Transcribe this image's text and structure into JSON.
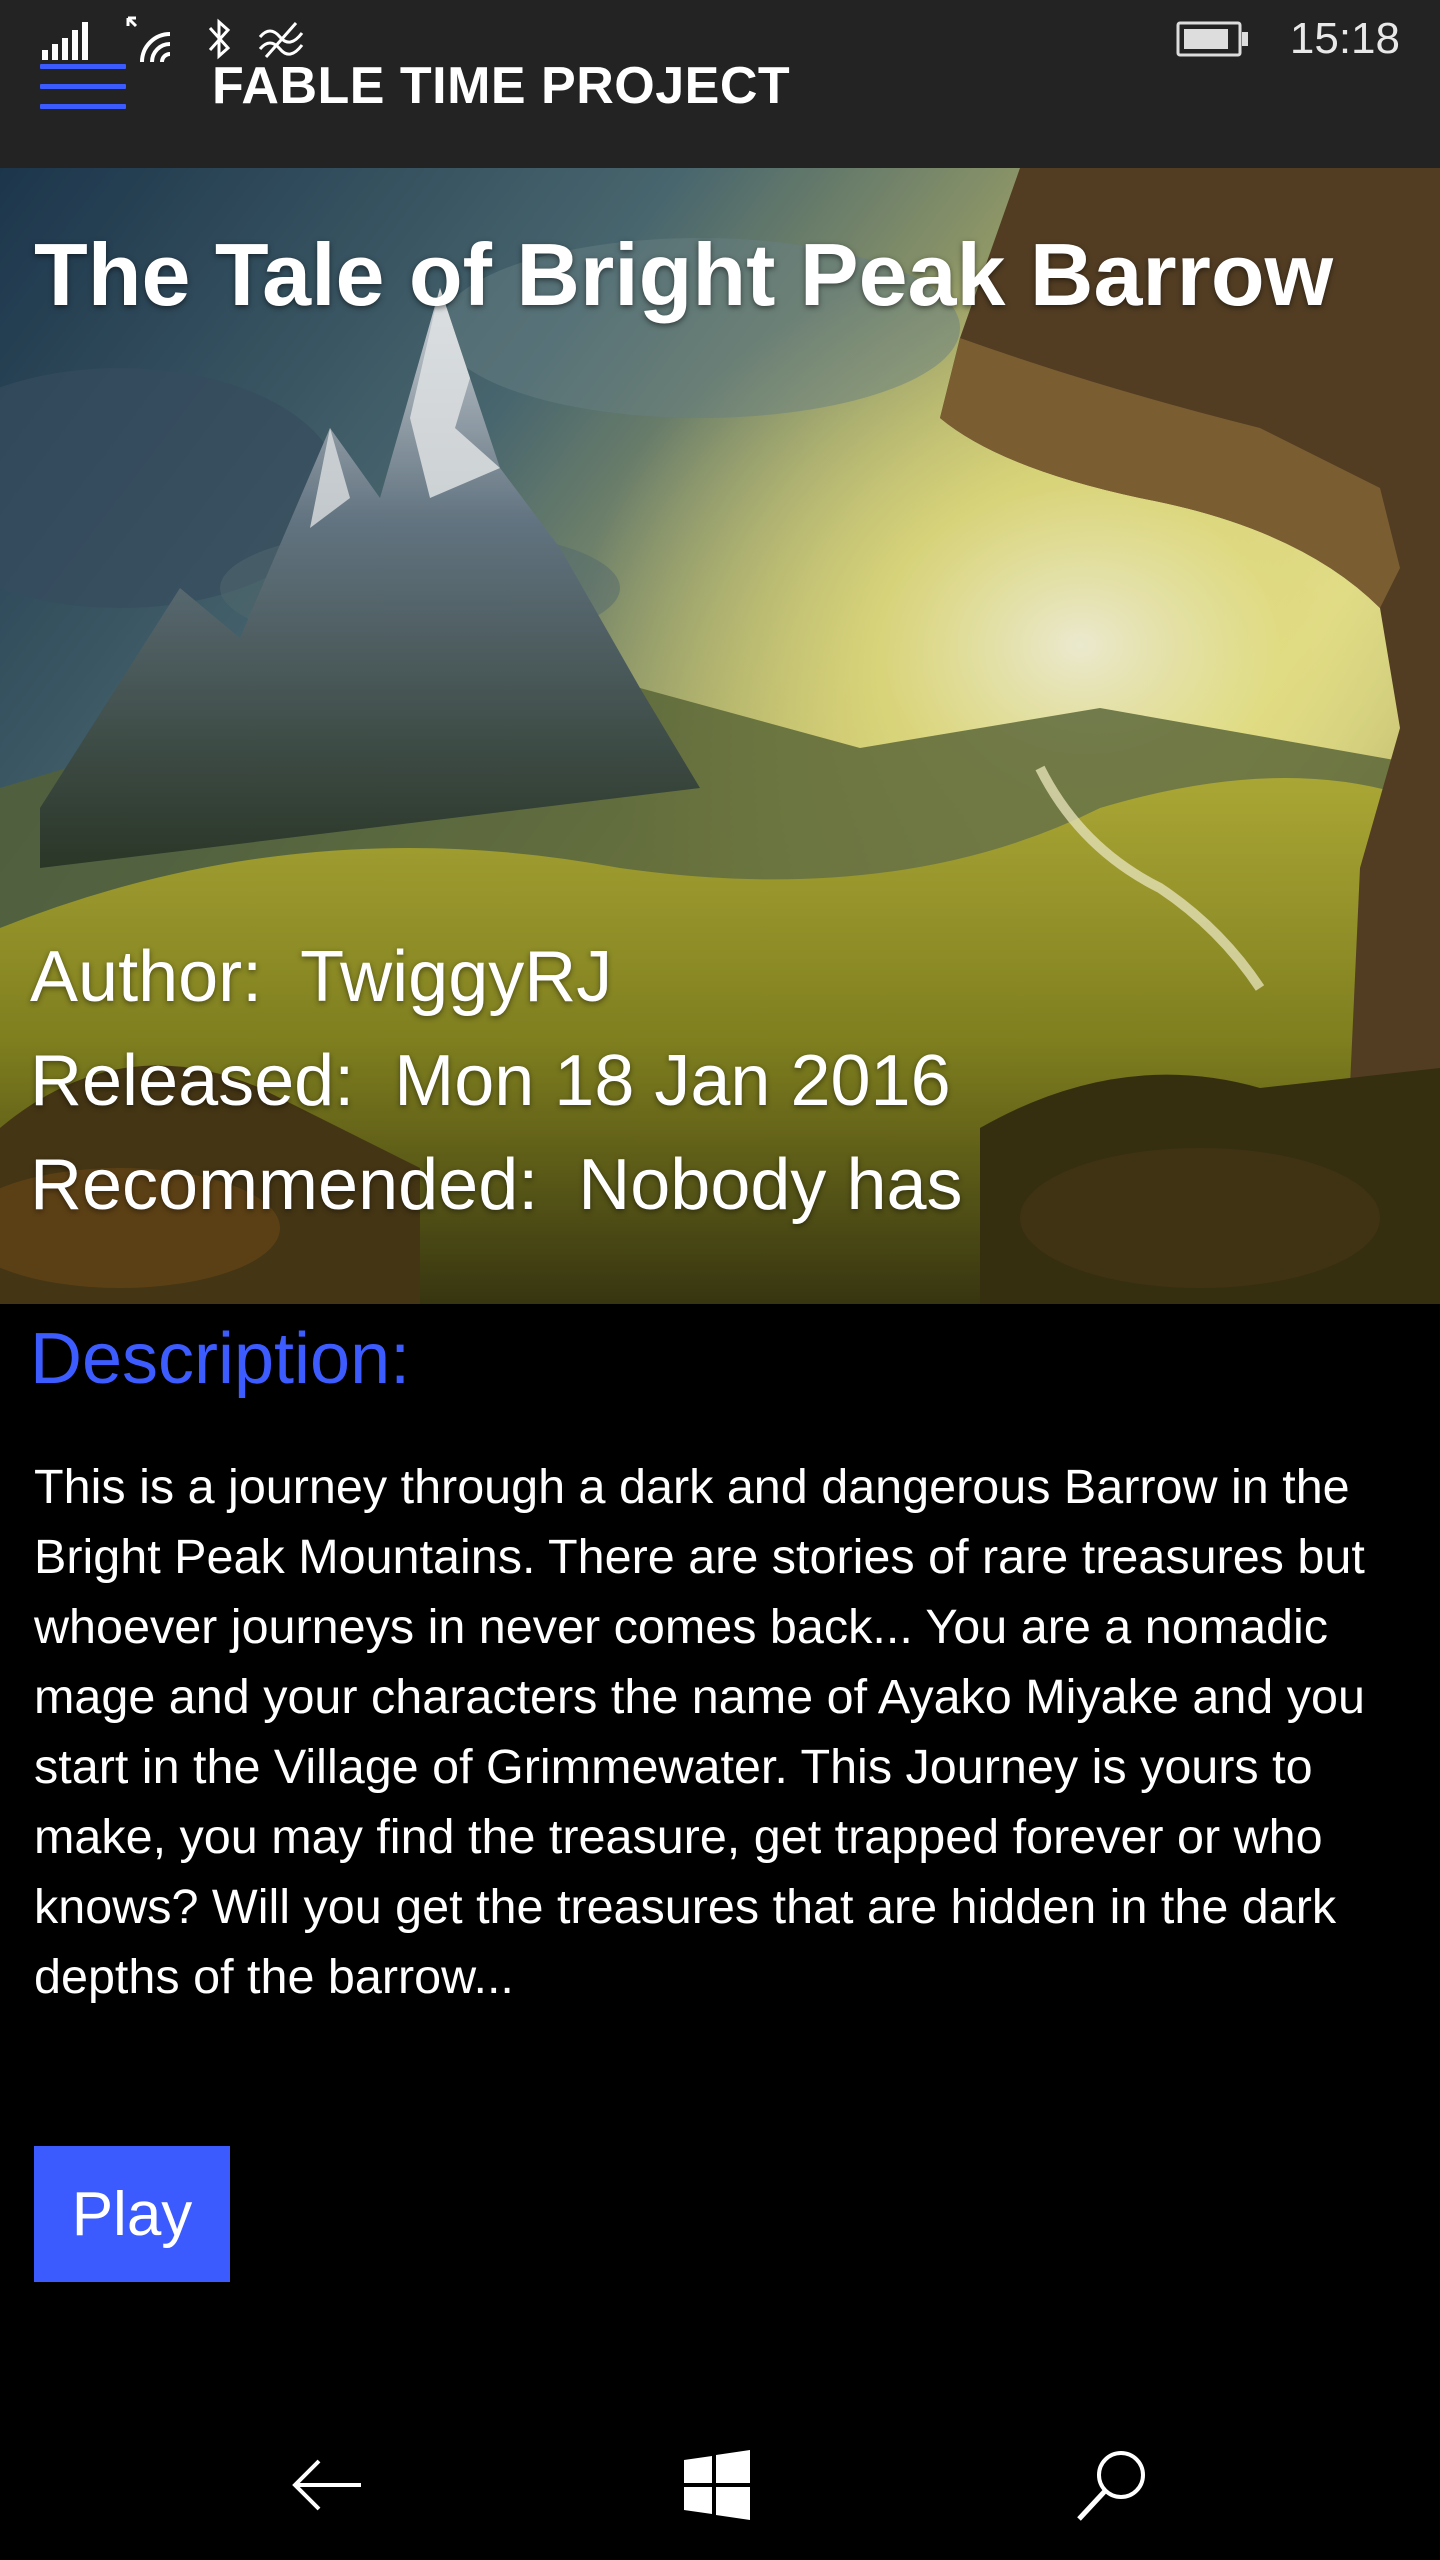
{
  "status_bar": {
    "time": "15:18",
    "icons": [
      "signal-icon",
      "wifi-icon",
      "bluetooth-icon",
      "data-sense-icon",
      "battery-icon"
    ]
  },
  "app_bar": {
    "title": "FABLE TIME PROJECT",
    "menu_icon": "hamburger-menu-icon"
  },
  "story": {
    "title": "The Tale of Bright Peak Barrow",
    "author_label": "Author:",
    "author_value": "TwiggyRJ",
    "released_label": "Released:",
    "released_value": "Mon 18 Jan 2016",
    "recommended_label": "Recommended:",
    "recommended_value": "Nobody has"
  },
  "description": {
    "heading": "Description:",
    "text": "This is a journey through a dark and dangerous Barrow in the Bright Peak Mountains. There are stories of rare treasures but whoever journeys in never comes back... You are a nomadic mage and your characters the name of Ayako Miyake and you start in the Village of Grimmewater. This Journey is yours to make, you may find the treasure, get trapped forever or who knows? Will you get the treasures that are hidden in the dark depths of the barrow..."
  },
  "actions": {
    "play_label": "Play"
  },
  "navbar": {
    "buttons": [
      "back-arrow-icon",
      "windows-logo-icon",
      "search-icon"
    ]
  },
  "colors": {
    "accent": "#3b5bff",
    "topbar_bg": "#232323",
    "background": "#000000"
  }
}
